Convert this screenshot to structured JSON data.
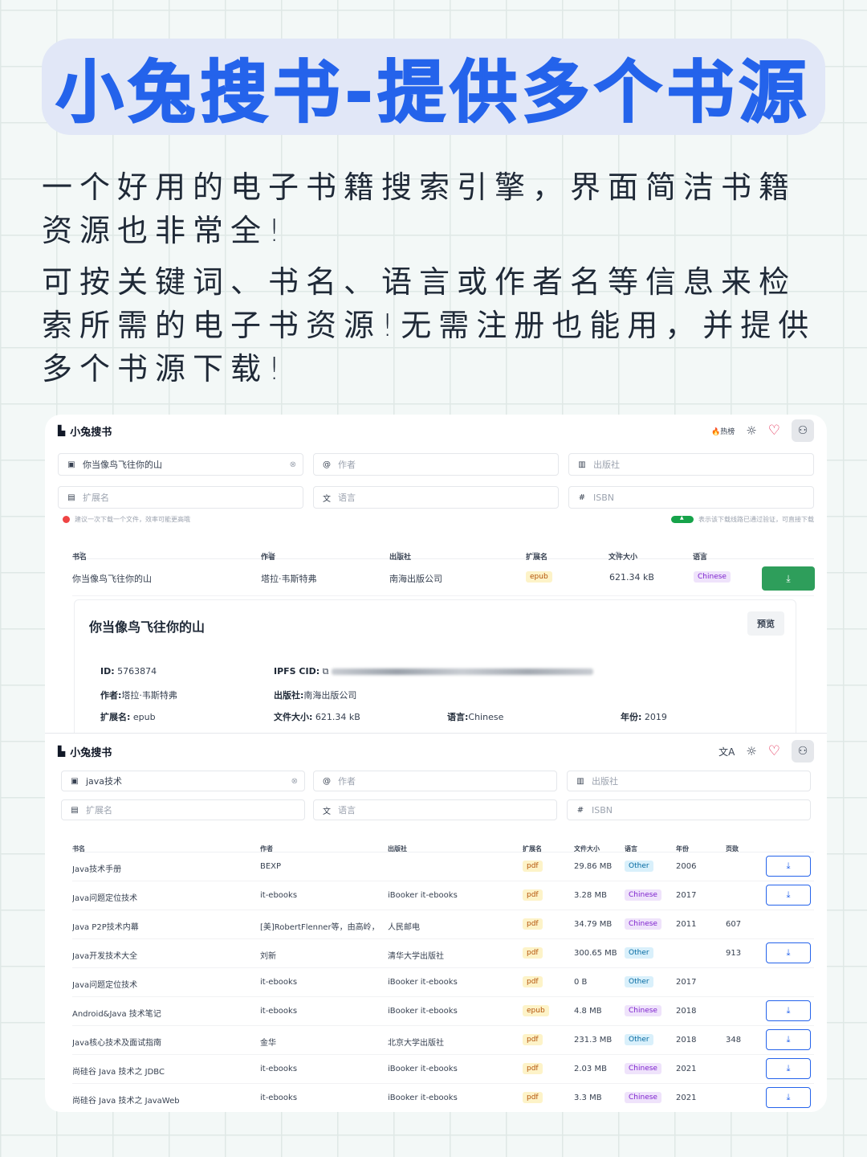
{
  "banner_title": "小兔搜书-提供多个书源",
  "intro1": "一个好用的电子书籍搜索引擎，界面简洁书籍资源也非常全!",
  "intro2": "可按关键词、书名、语言或作者名等信息来检索所需的电子书资源!无需注册也能用，并提供多个书源下载!",
  "app": {
    "brand": "小兔搜书",
    "hot_label": "热榜",
    "placeholders": {
      "author": "作者",
      "publisher": "出版社",
      "ext": "扩展名",
      "lang": "语言",
      "isbn": "ISBN"
    },
    "note_left": "建议一次下载一个文件，效率可能更高哦",
    "note_right": "表示该下载线路已通过验证，可直接下载",
    "columns": {
      "title": "书名",
      "author": "作者",
      "publisher": "出版社",
      "ext": "扩展名",
      "size": "文件大小",
      "lang": "语言",
      "year": "年份",
      "pages": "页数"
    }
  },
  "screen1": {
    "search_value": "你当像鸟飞往你的山",
    "result": {
      "title": "你当像鸟飞往你的山",
      "author": "塔拉·韦斯特弗",
      "publisher": "南海出版公司",
      "ext": "epub",
      "size": "621.34 kB",
      "lang": "Chinese"
    },
    "detail": {
      "title": "你当像鸟飞往你的山",
      "preview_label": "预览",
      "id_label": "ID:",
      "id": "5763874",
      "ipfs_label": "IPFS CID:",
      "author_label": "作者:",
      "author": "塔拉·韦斯特弗",
      "publisher_label": "出版社:",
      "publisher": "南海出版公司",
      "ext_label": "扩展名:",
      "ext": "epub",
      "size_label": "文件大小:",
      "size": "621.34 kB",
      "lang_label": "语言:",
      "lang": "Chinese",
      "year_label": "年份:",
      "year": "2019"
    }
  },
  "screen2": {
    "search_value": "java技术",
    "rows": [
      {
        "title": "Java技术手册",
        "author": "BEXP",
        "publisher": "",
        "ext": "pdf",
        "size": "29.86 MB",
        "lang": "Other",
        "year": "2006",
        "pages": "",
        "dl": true
      },
      {
        "title": "Java问题定位技术",
        "author": "it-ebooks",
        "publisher": "iBooker it-ebooks",
        "ext": "pdf",
        "size": "3.28 MB",
        "lang": "Chinese",
        "year": "2017",
        "pages": "",
        "dl": true
      },
      {
        "title": "Java P2P技术内幕",
        "author": "[美]RobertFlenner等，由高岭，",
        "publisher": "人民邮电",
        "ext": "pdf",
        "size": "34.79 MB",
        "lang": "Chinese",
        "year": "2011",
        "pages": "607",
        "dl": false
      },
      {
        "title": "Java开发技术大全",
        "author": "刘新",
        "publisher": "清华大学出版社",
        "ext": "pdf",
        "size": "300.65 MB",
        "lang": "Other",
        "year": "",
        "pages": "913",
        "dl": true
      },
      {
        "title": "Java问题定位技术",
        "author": "it-ebooks",
        "publisher": "iBooker it-ebooks",
        "ext": "pdf",
        "size": "0 B",
        "lang": "Other",
        "year": "2017",
        "pages": "",
        "dl": false
      },
      {
        "title": "Android&Java 技术笔记",
        "author": "it-ebooks",
        "publisher": "iBooker it-ebooks",
        "ext": "epub",
        "size": "4.8 MB",
        "lang": "Chinese",
        "year": "2018",
        "pages": "",
        "dl": true
      },
      {
        "title": "Java核心技术及面试指南",
        "author": "金华",
        "publisher": "北京大学出版社",
        "ext": "pdf",
        "size": "231.3 MB",
        "lang": "Other",
        "year": "2018",
        "pages": "348",
        "dl": true
      },
      {
        "title": "尚硅谷 Java 技术之 JDBC",
        "author": "it-ebooks",
        "publisher": "iBooker it-ebooks",
        "ext": "pdf",
        "size": "2.03 MB",
        "lang": "Chinese",
        "year": "2021",
        "pages": "",
        "dl": true
      },
      {
        "title": "尚硅谷 Java 技术之 JavaWeb",
        "author": "it-ebooks",
        "publisher": "iBooker it-ebooks",
        "ext": "pdf",
        "size": "3.3 MB",
        "lang": "Chinese",
        "year": "2021",
        "pages": "",
        "dl": true
      }
    ]
  }
}
